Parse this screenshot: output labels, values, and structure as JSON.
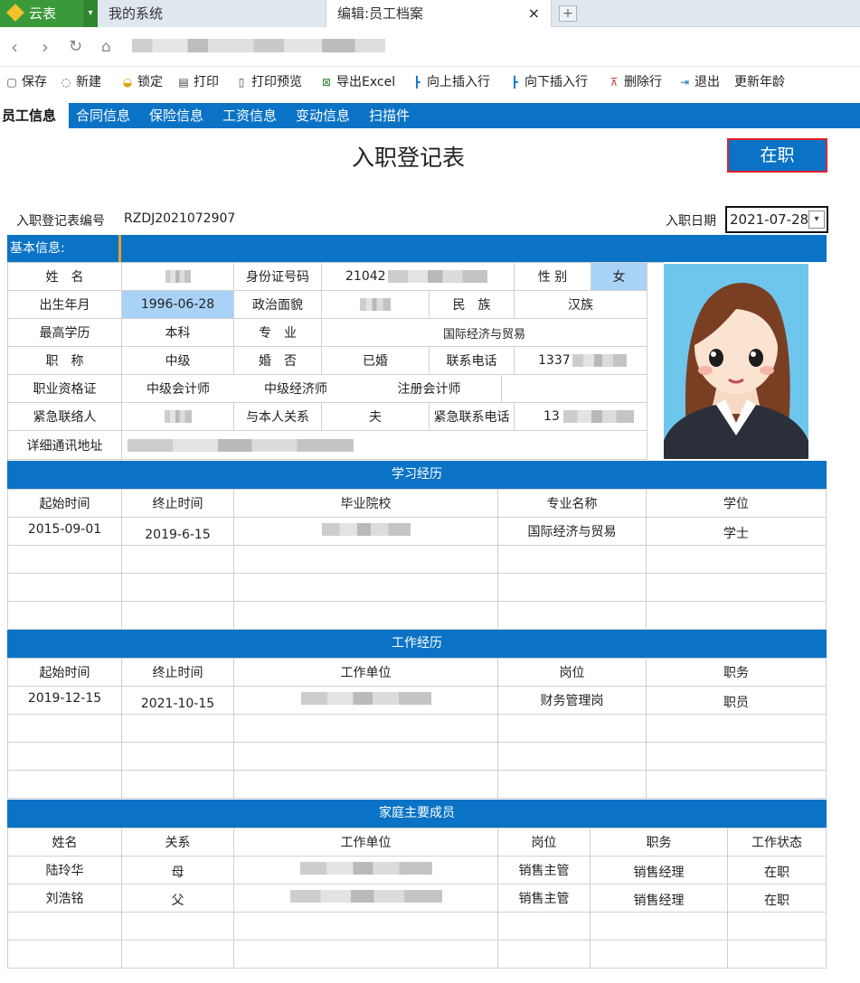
{
  "browser": {
    "brand": "云表",
    "tabs": [
      {
        "label": "我的系统"
      },
      {
        "label": "编辑:员工档案"
      }
    ],
    "close_glyph": "×",
    "new_tab_glyph": "+"
  },
  "toolbar": [
    {
      "icon": "save-icon",
      "label": "保存"
    },
    {
      "icon": "new-icon",
      "label": "新建"
    },
    {
      "icon": "lock-icon",
      "label": "锁定"
    },
    {
      "icon": "print-icon",
      "label": "打印"
    },
    {
      "icon": "print-preview-icon",
      "label": "打印预览"
    },
    {
      "icon": "excel-icon",
      "label": "导出Excel"
    },
    {
      "icon": "insert-above-icon",
      "label": "向上插入行"
    },
    {
      "icon": "insert-below-icon",
      "label": "向下插入行"
    },
    {
      "icon": "delete-row-icon",
      "label": "删除行"
    },
    {
      "icon": "exit-icon",
      "label": "退出"
    },
    {
      "icon": "",
      "label": "更新年龄"
    }
  ],
  "module_tabs": [
    "员工信息",
    "合同信息",
    "保险信息",
    "工资信息",
    "变动信息",
    "扫描件"
  ],
  "form": {
    "title": "入职登记表",
    "status": "在职",
    "reg_no_label": "入职登记表编号",
    "reg_no": "RZDJ2021072907",
    "entry_date_label": "入职日期",
    "entry_date": "2021-07-28"
  },
  "basic": {
    "section": "基本信息:",
    "name_label": "姓　名",
    "id_label": "身份证号码",
    "id_value": "21042",
    "gender_label": "性 别",
    "gender": "女",
    "birth_label": "出生年月",
    "birth": "1996-06-28",
    "politics_label": "政治面貌",
    "ethnic_label": "民　族",
    "ethnic": "汉族",
    "edu_label": "最高学历",
    "edu": "本科",
    "major_label": "专　业",
    "major": "国际经济与贸易",
    "title_label": "职　称",
    "title_value": "中级",
    "marry_label": "婚　否",
    "marry": "已婚",
    "phone_label": "联系电话",
    "phone": "1337",
    "cert_label": "职业资格证",
    "certs": [
      "中级会计师",
      "中级经济师",
      "注册会计师"
    ],
    "emergency_label": "紧急联络人",
    "relation_label": "与本人关系",
    "relation": "夫",
    "emergency_phone_label": "紧急联系电话",
    "emergency_phone": "13",
    "address_label": "详细通讯地址"
  },
  "education": {
    "section": "学习经历",
    "headers": [
      "起始时间",
      "终止时间",
      "毕业院校",
      "专业名称",
      "学位"
    ],
    "rows": [
      [
        "2015-09-01",
        "2019-6-15",
        "",
        "国际经济与贸易",
        "学士"
      ]
    ]
  },
  "work": {
    "section": "工作经历",
    "headers": [
      "起始时间",
      "终止时间",
      "工作单位",
      "岗位",
      "职务"
    ],
    "rows": [
      [
        "2019-12-15",
        "2021-10-15",
        "",
        "财务管理岗",
        "职员"
      ]
    ]
  },
  "family": {
    "section": "家庭主要成员",
    "headers": [
      "姓名",
      "关系",
      "工作单位",
      "岗位",
      "职务",
      "工作状态"
    ],
    "rows": [
      [
        "陆玲华",
        "母",
        "",
        "销售主管",
        "销售经理",
        "在职"
      ],
      [
        "刘浩铭",
        "父",
        "",
        "销售主管",
        "销售经理",
        "在职"
      ]
    ]
  },
  "colors": {
    "accent": "#0b73c5",
    "highlight": "#a9d2f7",
    "status_border": "#e0222e",
    "brand": "#3a9a3a"
  }
}
